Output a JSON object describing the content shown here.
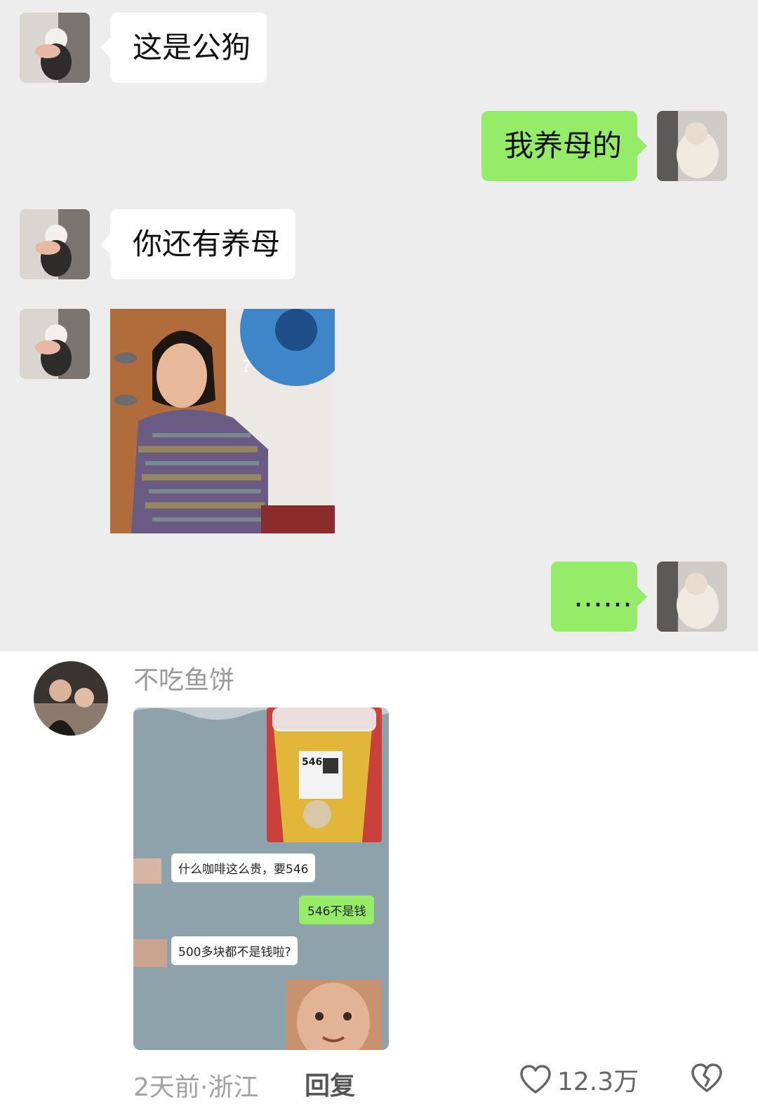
{
  "chat": {
    "messages": [
      {
        "text": "这是公狗"
      },
      {
        "text": "我养母的"
      },
      {
        "text": "你还有养母"
      },
      {
        "text": "……"
      }
    ]
  },
  "comment": {
    "username": "不吃鱼饼",
    "time": "2天前",
    "location": "浙江",
    "reply_label": "回复",
    "likes": "12.3万",
    "inner_chat": {
      "cup_number": "546",
      "msg1": "什么咖啡这么贵，要546",
      "msg2": "546不是钱",
      "msg3": "500多块都不是钱啦?"
    }
  },
  "icons": [
    "heart-icon",
    "broken-heart-icon"
  ]
}
